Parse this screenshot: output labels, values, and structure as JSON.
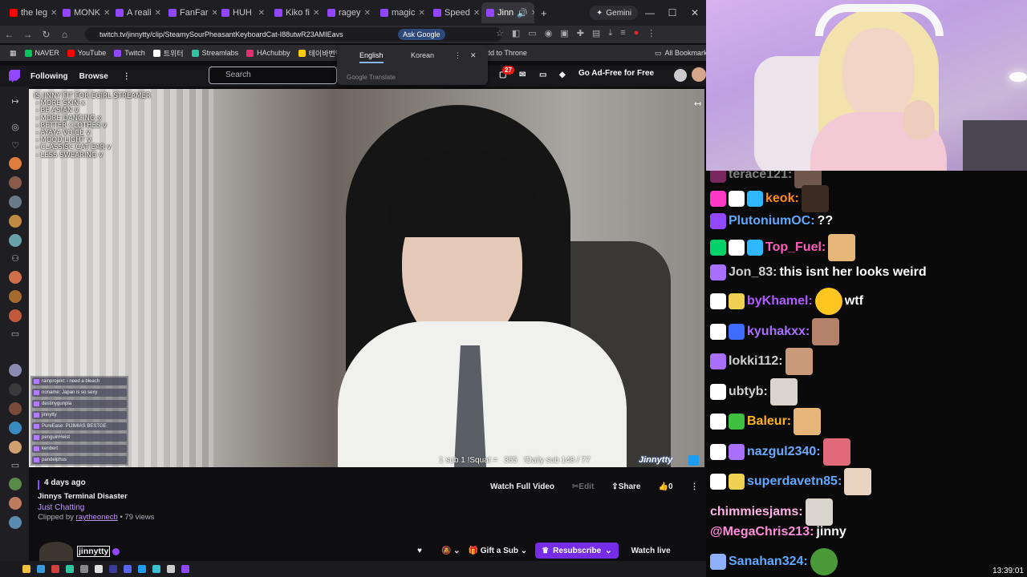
{
  "browser": {
    "tabs": [
      {
        "label": "the leg",
        "color": "#ff0000"
      },
      {
        "label": "MONK",
        "color": "#9146ff"
      },
      {
        "label": "A reali",
        "color": "#9146ff"
      },
      {
        "label": "FanFar",
        "color": "#9146ff"
      },
      {
        "label": "HUH",
        "color": "#9146ff"
      },
      {
        "label": "Kiko fi",
        "color": "#9146ff"
      },
      {
        "label": "ragey",
        "color": "#9146ff"
      },
      {
        "label": "magic",
        "color": "#9146ff"
      },
      {
        "label": "Speed",
        "color": "#9146ff"
      },
      {
        "label": "Jinn",
        "color": "#9146ff"
      }
    ],
    "gemini_label": "Gemini",
    "url": "twitch.tv/jinnytty/clip/SteamySourPheasantKeyboardCat-I88utwR23AMIEavs",
    "ask_google": "Ask Google",
    "bookmarks": [
      {
        "label": "NAVER",
        "color": "#03c75a"
      },
      {
        "label": "YouTube",
        "color": "#ff0000"
      },
      {
        "label": "Twitch",
        "color": "#9146ff"
      },
      {
        "label": "트위터",
        "color": "#ffffff"
      },
      {
        "label": "Streamlabs",
        "color": "#31c3a2"
      },
      {
        "label": "HAchubby",
        "color": "#e1306c"
      },
      {
        "label": "테이바번역기",
        "color": "#ffcc00"
      }
    ],
    "throne_label": "dd to Throne",
    "all_bookmarks": "All Bookmarks",
    "translate": {
      "lang1": "English",
      "lang2": "Korean",
      "powered": "Google Translate"
    }
  },
  "twitch_nav": {
    "following": "Following",
    "browse": "Browse",
    "search_placeholder": "Search",
    "notifications_count": "27",
    "ad_free": "Go Ad-Free for Free"
  },
  "video": {
    "overlay_text": "IS JINNY FIT FOR EGIRL STREAMER\n - MORE SKIN x\n - BE ASIAN v\n - MORE DANCING x\n - BETTER CLOTHES v\n - AYAYA VOICE v\n - MOOD LIGHT v\n - CLASSISC CAT EAR v\n - LESS SWEARING v",
    "mini_chat": [
      "rainprojekt: i need a bleach",
      "noname: Japan is so sexy",
      "destinygunpla",
      "jinnytty",
      "PureEase: PIJIMIAS BESTGE",
      "penguinHeist",
      "kenbert",
      "pandelphus"
    ],
    "sub_text": "1 sub 1 !Squat =",
    "squat_count": "355",
    "daily_sub": "!Daily sub 148 / 77",
    "signature": "Jinnytty"
  },
  "clip": {
    "date": "4 days ago",
    "title": "Jinnys Terminal Disaster",
    "category": "Just Chatting",
    "clipped_by_prefix": "Clipped by",
    "clipper": "raytheonecb",
    "views": "• 79 views",
    "watch_full": "Watch Full Video",
    "edit": "Edit",
    "share": "Share",
    "likes": "0"
  },
  "channel": {
    "name": "jinnytty",
    "gift_sub": "Gift a Sub",
    "resubscribe": "Resubscribe",
    "watch_live": "Watch live"
  },
  "chat": {
    "messages": [
      {
        "user": "terace121:",
        "color": "#cfcfcf",
        "text": "",
        "badges": [
          "#c23b98"
        ],
        "emote": "#b48a7a"
      },
      {
        "user": "keok:",
        "color": "#ff8c1a",
        "text": "",
        "badges": [
          "#ff38c5",
          "#ffffff",
          "#2fb8ff"
        ],
        "emote": "#3a2a22"
      },
      {
        "user": "PlutoniumOC:",
        "color": "#5fa8ff",
        "text": "??",
        "badges": [
          "#9146ff"
        ],
        "emote": ""
      },
      {
        "user": "Top_Fuel:",
        "color": "#ff5bbd",
        "text": "",
        "badges": [
          "#00d26a",
          "#ffffff",
          "#2fb8ff"
        ],
        "emote": "#e6b679"
      },
      {
        "user": "Jon_83:",
        "color": "#cfcfcf",
        "text": "this isnt her looks weird",
        "badges": [
          "#a970ff"
        ],
        "emote": ""
      },
      {
        "user": "byKhamel:",
        "color": "#b05bff",
        "text": "wtf",
        "badges": [
          "#ffffff",
          "#f0d050"
        ],
        "emote": "#ffc520"
      },
      {
        "user": "kyuhakxx:",
        "color": "#a970ff",
        "text": "",
        "badges": [
          "#ffffff",
          "#3f6bff"
        ],
        "emote": "#b4826a"
      },
      {
        "user": "lokki112:",
        "color": "#cfcfcf",
        "text": "",
        "badges": [
          "#a970ff"
        ],
        "emote": "#c89a7a"
      },
      {
        "user": "ubtyb:",
        "color": "#cfcfcf",
        "text": "",
        "badges": [
          "#ffffff"
        ],
        "emote": "#d9d4cc"
      },
      {
        "user": "Baleur:",
        "color": "#ffb31a",
        "text": "",
        "badges": [
          "#ffffff",
          "#3fbf3f"
        ],
        "emote": "#e6b679"
      },
      {
        "user": "nazgul2340:",
        "color": "#6ca9ff",
        "text": "",
        "badges": [
          "#ffffff",
          "#a970ff"
        ],
        "emote": "#e06a7a"
      },
      {
        "user": "superdavetn85:",
        "color": "#5fa8ff",
        "text": "",
        "badges": [
          "#ffffff",
          "#f0d050"
        ],
        "emote": "#e8d2c0"
      },
      {
        "user": "chimmiesjams:",
        "color": "#ffb3e6",
        "text": "",
        "badges": [],
        "emote": "#d9d4cc"
      },
      {
        "user": "@MegaChris213:",
        "color": "#ff8cdb",
        "text": "jinny",
        "badges": [],
        "emote": ""
      },
      {
        "user": "Sanahan324:",
        "color": "#5fa8ff",
        "text": "",
        "badges": [
          "#8fb0ff"
        ],
        "emote": "#4a9a3a"
      }
    ],
    "clock": "13:39:01"
  }
}
